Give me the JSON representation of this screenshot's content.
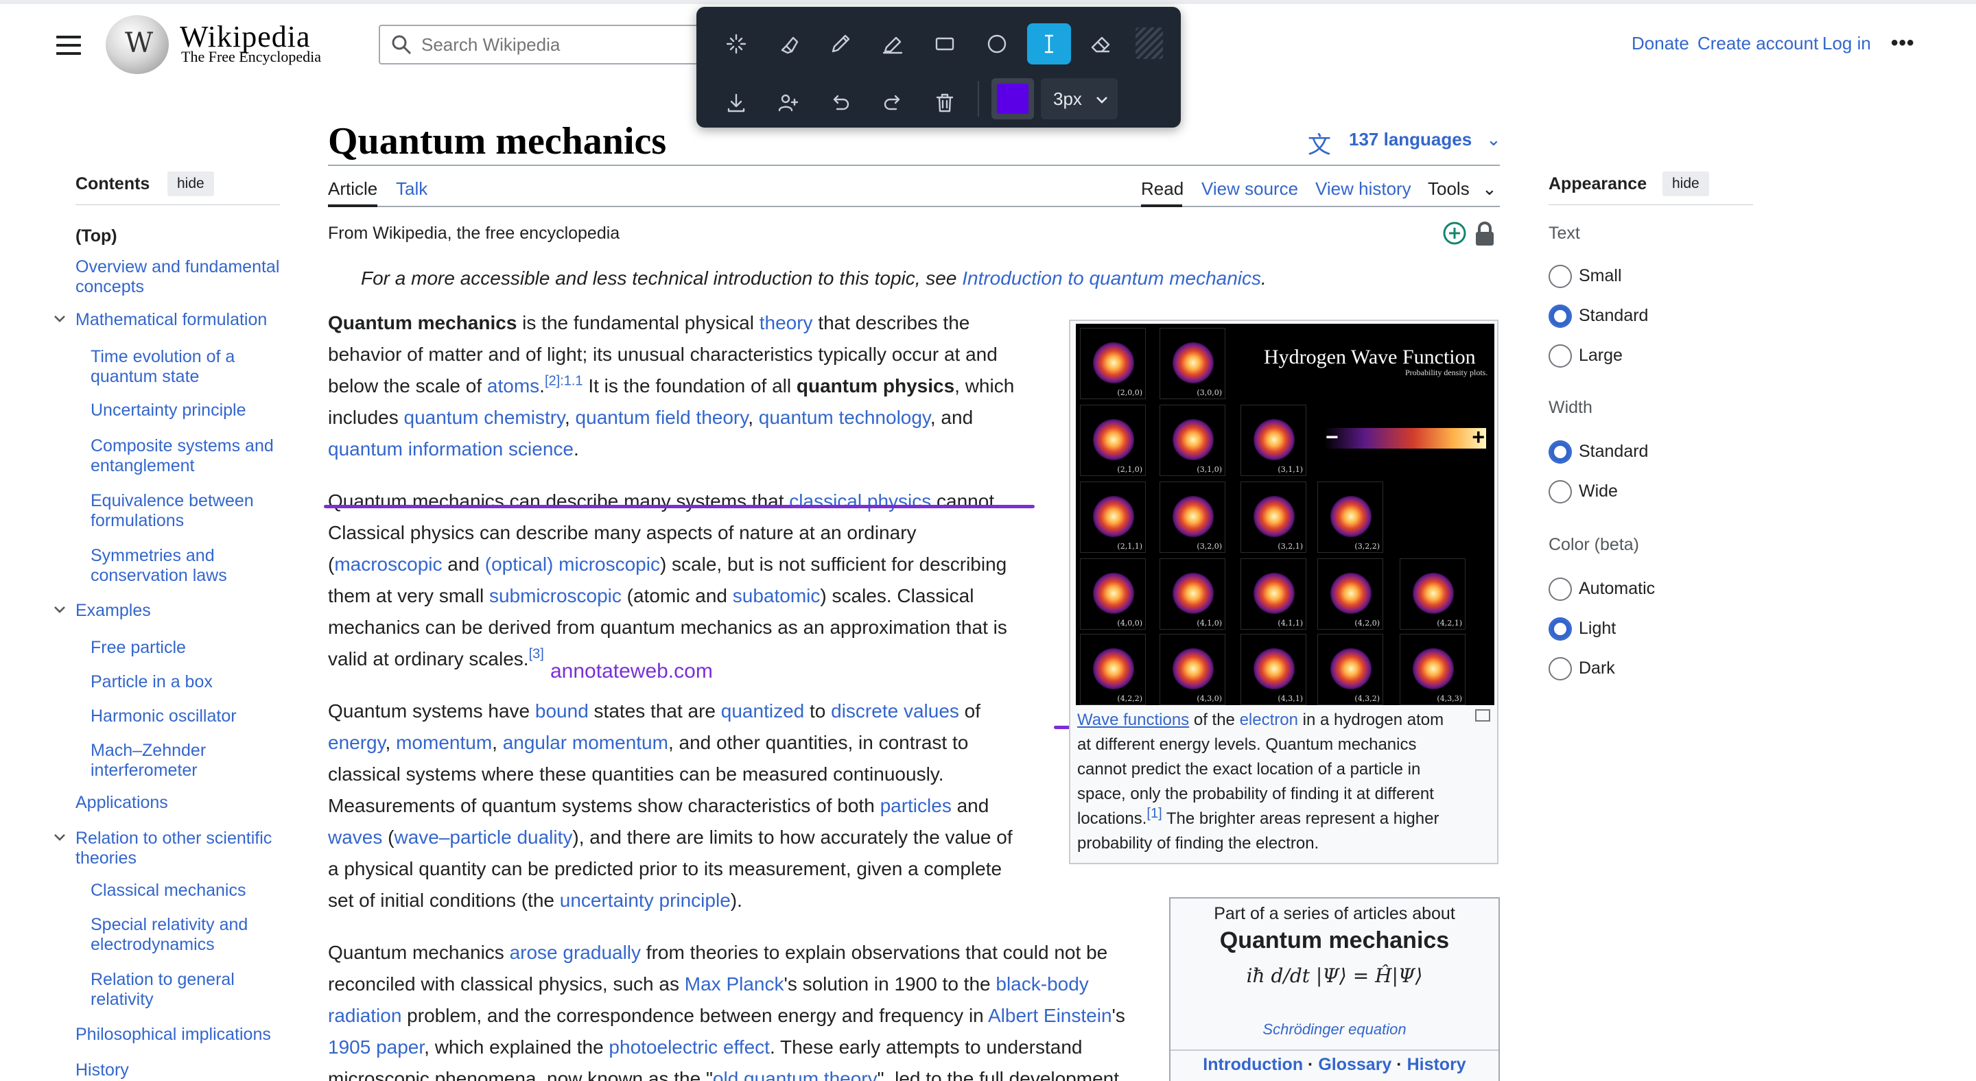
{
  "header": {
    "logo_wordmark": "Wikipedia",
    "logo_tagline": "The Free Encyclopedia",
    "search_placeholder": "Search Wikipedia",
    "links": [
      "Donate",
      "Create account",
      "Log in"
    ],
    "more_icon": "ellipsis-icon"
  },
  "annotation_toolbar": {
    "row1_tools": [
      "magic-select-icon",
      "highlighter-icon",
      "pen-icon",
      "marker-icon",
      "rectangle-icon",
      "circle-icon",
      "text-cursor-icon",
      "eraser-icon",
      "pattern-icon"
    ],
    "active_tool": "text-cursor-icon",
    "row2_tools": [
      "download-icon",
      "add-user-icon",
      "undo-icon",
      "redo-icon",
      "trash-icon"
    ],
    "color": "#5b00e6",
    "stroke_size": "3px"
  },
  "article": {
    "title": "Quantum mechanics",
    "languages": "137 languages",
    "tabs_left": [
      "Article",
      "Talk"
    ],
    "tabs_right": [
      "Read",
      "View source",
      "View history",
      "Tools"
    ],
    "tagline": "From Wikipedia, the free encyclopedia",
    "hatnote_prefix": "For a more accessible and less technical introduction to this topic, see ",
    "hatnote_link": "Introduction to quantum mechanics",
    "hatnote_suffix": "."
  },
  "toc": {
    "heading": "Contents",
    "hide_label": "hide",
    "items": [
      {
        "label": "(Top)",
        "level": 0
      },
      {
        "label": "Overview and fundamental concepts",
        "level": 0
      },
      {
        "label": "Mathematical formulation",
        "level": 0,
        "expanded": true
      },
      {
        "label": "Time evolution of a quantum state",
        "level": 1
      },
      {
        "label": "Uncertainty principle",
        "level": 1
      },
      {
        "label": "Composite systems and entanglement",
        "level": 1
      },
      {
        "label": "Equivalence between formulations",
        "level": 1
      },
      {
        "label": "Symmetries and conservation laws",
        "level": 1
      },
      {
        "label": "Examples",
        "level": 0,
        "expanded": true
      },
      {
        "label": "Free particle",
        "level": 1
      },
      {
        "label": "Particle in a box",
        "level": 1
      },
      {
        "label": "Harmonic oscillator",
        "level": 1
      },
      {
        "label": "Mach–Zehnder interferometer",
        "level": 1
      },
      {
        "label": "Applications",
        "level": 0
      },
      {
        "label": "Relation to other scientific theories",
        "level": 0,
        "expanded": true
      },
      {
        "label": "Classical mechanics",
        "level": 1
      },
      {
        "label": "Special relativity and electrodynamics",
        "level": 1
      },
      {
        "label": "Relation to general relativity",
        "level": 1
      },
      {
        "label": "Philosophical implications",
        "level": 0
      },
      {
        "label": "History",
        "level": 0
      }
    ]
  },
  "appearance": {
    "heading": "Appearance",
    "hide_label": "hide",
    "groups": [
      {
        "label": "Text",
        "options": [
          "Small",
          "Standard",
          "Large"
        ],
        "selected": "Standard"
      },
      {
        "label": "Width",
        "options": [
          "Standard",
          "Wide"
        ],
        "selected": "Standard"
      },
      {
        "label": "Color (beta)",
        "options": [
          "Automatic",
          "Light",
          "Dark"
        ],
        "selected": "Light"
      }
    ]
  },
  "figure": {
    "image_title": "Hydrogen Wave Function",
    "image_subtitle": "Probability density plots.",
    "orbital_labels": [
      "(2,0,0)",
      "(3,0,0)",
      "(2,1,0)",
      "(3,1,0)",
      "(3,1,1)",
      "(2,1,1)",
      "(3,2,0)",
      "(3,2,1)",
      "(3,2,2)",
      "(4,0,0)",
      "(4,1,0)",
      "(4,1,1)",
      "(4,2,0)",
      "(4,2,1)",
      "(4,2,2)",
      "(4,3,0)",
      "(4,3,1)",
      "(4,3,2)",
      "(4,3,3)"
    ],
    "caption_link1": "Wave functions",
    "caption_text1": " of the ",
    "caption_link2": "electron",
    "caption_text2": " in a hydrogen atom",
    "caption_lines": [
      "at different energy levels. Quantum mechanics",
      "cannot predict the exact location of a particle in",
      "space, only the probability of finding it at different"
    ],
    "caption_line5_prefix": "locations.",
    "caption_ref": "[1]",
    "caption_line5_suffix": " The brighter areas represent a higher",
    "caption_line6": "probability of finding the electron."
  },
  "series_box": {
    "intro": "Part of a series of articles about",
    "title": "Quantum mechanics",
    "equation": "iħ d/dt |Ψ⟩ = Ĥ|Ψ⟩",
    "equation_caption": "Schrödinger equation",
    "links": [
      "Introduction",
      "Glossary",
      "History"
    ]
  },
  "annotation_overlay": {
    "watermark_text": "annotateweb.com",
    "stroke_color": "#7a2fd6"
  },
  "paragraphs": {
    "p1": [
      [
        {
          "b": "Quantum mechanics"
        },
        {
          "t": " is the fundamental physical "
        },
        {
          "a": "theory"
        },
        {
          "t": " that describes the"
        }
      ],
      [
        {
          "t": "behavior of matter and of light; its unusual characteristics typically occur at and"
        }
      ],
      [
        {
          "t": "below the scale of "
        },
        {
          "a": "atoms"
        },
        {
          "t": "."
        },
        {
          "s": "[2]:1.1"
        },
        {
          "t": " It is the foundation of all "
        },
        {
          "b": "quantum physics"
        },
        {
          "t": ", which"
        }
      ],
      [
        {
          "t": "includes "
        },
        {
          "a": "quantum chemistry"
        },
        {
          "t": ", "
        },
        {
          "a": "quantum field theory"
        },
        {
          "t": ", "
        },
        {
          "a": "quantum technology"
        },
        {
          "t": ", and"
        }
      ],
      [
        {
          "a": "quantum information science"
        },
        {
          "t": "."
        }
      ]
    ],
    "p2": [
      [
        {
          "t": "Quantum mechanics can describe many systems that "
        },
        {
          "a": "classical physics"
        },
        {
          "t": " cannot."
        }
      ],
      [
        {
          "t": "Classical physics can describe many aspects of nature at an ordinary"
        }
      ],
      [
        {
          "t": "("
        },
        {
          "a": "macroscopic"
        },
        {
          "t": " and "
        },
        {
          "a": "(optical) microscopic"
        },
        {
          "t": ") scale, but is not sufficient for describing"
        }
      ],
      [
        {
          "t": "them at very small "
        },
        {
          "a": "submicroscopic"
        },
        {
          "t": " (atomic and "
        },
        {
          "a": "subatomic"
        },
        {
          "t": ") scales. Classical"
        }
      ],
      [
        {
          "t": "mechanics can be derived from quantum mechanics as an approximation that is"
        }
      ],
      [
        {
          "t": "valid at ordinary scales."
        },
        {
          "s": "[3]"
        }
      ]
    ],
    "p3": [
      [
        {
          "t": "Quantum systems have "
        },
        {
          "a": "bound"
        },
        {
          "t": " states that are "
        },
        {
          "a": "quantized"
        },
        {
          "t": " to "
        },
        {
          "a": "discrete values"
        },
        {
          "t": " of"
        }
      ],
      [
        {
          "a": "energy"
        },
        {
          "t": ", "
        },
        {
          "a": "momentum"
        },
        {
          "t": ", "
        },
        {
          "a": "angular momentum"
        },
        {
          "t": ", and other quantities, in contrast to"
        }
      ],
      [
        {
          "t": "classical systems where these quantities can be measured continuously."
        }
      ],
      [
        {
          "t": "Measurements of quantum systems show characteristics of both "
        },
        {
          "a": "particles"
        },
        {
          "t": " and"
        }
      ],
      [
        {
          "a": "waves"
        },
        {
          "t": " ("
        },
        {
          "a": "wave–particle duality"
        },
        {
          "t": "), and there are limits to how accurately the value of"
        }
      ],
      [
        {
          "t": "a physical quantity can be predicted prior to its measurement, given a complete"
        }
      ],
      [
        {
          "t": "set of initial conditions (the "
        },
        {
          "a": "uncertainty principle"
        },
        {
          "t": ")."
        }
      ]
    ],
    "p4": [
      [
        {
          "t": "Quantum mechanics "
        },
        {
          "a": "arose gradually"
        },
        {
          "t": " from theories to explain observations that could not be"
        }
      ],
      [
        {
          "t": "reconciled with classical physics, such as "
        },
        {
          "a": "Max Planck"
        },
        {
          "t": "'s solution in 1900 to the "
        },
        {
          "a": "black-body"
        }
      ],
      [
        {
          "a": "radiation"
        },
        {
          "t": " problem, and the correspondence between energy and frequency in "
        },
        {
          "a": "Albert Einstein"
        },
        {
          "t": "'s"
        }
      ],
      [
        {
          "a": "1905 paper"
        },
        {
          "t": ", which explained the "
        },
        {
          "a": "photoelectric effect"
        },
        {
          "t": ". These early attempts to understand"
        }
      ],
      [
        {
          "t": "microscopic phenomena, now known as the \""
        },
        {
          "a": "old quantum theory"
        },
        {
          "t": "\", led to the full development"
        }
      ]
    ]
  }
}
